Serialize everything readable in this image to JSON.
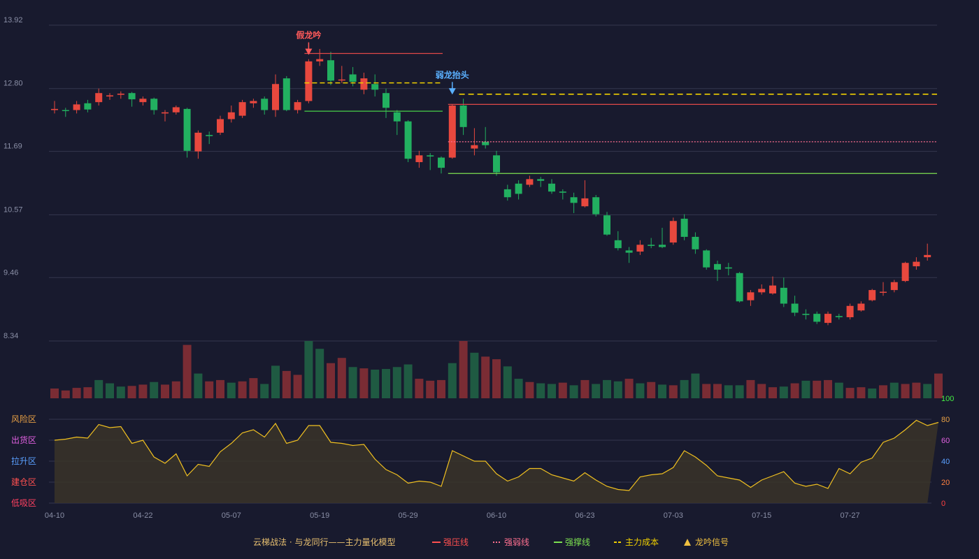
{
  "chart_data": {
    "type": "candlestick",
    "price_axis": {
      "ticks": [
        "13.92",
        "12.80",
        "11.69",
        "10.57",
        "9.46",
        "8.34"
      ],
      "min": 8.34,
      "max": 13.92
    },
    "date_ticks": [
      {
        "i": 0,
        "label": "04-10"
      },
      {
        "i": 8,
        "label": "04-22"
      },
      {
        "i": 16,
        "label": "05-07"
      },
      {
        "i": 24,
        "label": "05-19"
      },
      {
        "i": 32,
        "label": "05-29"
      },
      {
        "i": 40,
        "label": "06-10"
      },
      {
        "i": 48,
        "label": "06-23"
      },
      {
        "i": 56,
        "label": "07-03"
      },
      {
        "i": 64,
        "label": "07-15"
      },
      {
        "i": 72,
        "label": "07-27"
      }
    ],
    "candles": [
      [
        12.42,
        12.44,
        12.58,
        12.36
      ],
      [
        12.42,
        12.41,
        12.46,
        12.3
      ],
      [
        12.42,
        12.52,
        12.58,
        12.36
      ],
      [
        12.54,
        12.43,
        12.6,
        12.38
      ],
      [
        12.56,
        12.72,
        12.8,
        12.5
      ],
      [
        12.66,
        12.68,
        12.72,
        12.6
      ],
      [
        12.69,
        12.71,
        12.75,
        12.62
      ],
      [
        12.72,
        12.61,
        12.74,
        12.48
      ],
      [
        12.56,
        12.62,
        12.66,
        12.5
      ],
      [
        12.62,
        12.42,
        12.64,
        12.34
      ],
      [
        12.36,
        12.38,
        12.42,
        12.22
      ],
      [
        12.38,
        12.47,
        12.5,
        12.34
      ],
      [
        12.44,
        11.7,
        12.46,
        11.58
      ],
      [
        11.69,
        12.02,
        12.06,
        11.56
      ],
      [
        11.98,
        11.96,
        12.04,
        11.82
      ],
      [
        12.02,
        12.26,
        12.32,
        11.98
      ],
      [
        12.26,
        12.38,
        12.5,
        12.2
      ],
      [
        12.32,
        12.56,
        12.6,
        12.28
      ],
      [
        12.54,
        12.58,
        12.62,
        12.46
      ],
      [
        12.62,
        12.42,
        12.66,
        12.34
      ],
      [
        12.42,
        12.88,
        13.05,
        12.3
      ],
      [
        12.98,
        12.42,
        13.02,
        12.4
      ],
      [
        12.42,
        12.56,
        12.6,
        12.36
      ],
      [
        12.58,
        13.28,
        13.32,
        12.54
      ],
      [
        13.28,
        13.32,
        13.5,
        13.2
      ],
      [
        13.3,
        12.94,
        13.45,
        12.86
      ],
      [
        12.95,
        12.96,
        13.2,
        12.9
      ],
      [
        13.05,
        12.92,
        13.18,
        12.84
      ],
      [
        12.78,
        12.98,
        13.08,
        12.7
      ],
      [
        12.88,
        12.78,
        13.05,
        12.66
      ],
      [
        12.72,
        12.46,
        12.8,
        12.28
      ],
      [
        12.38,
        12.22,
        12.42,
        11.98
      ],
      [
        12.22,
        11.56,
        12.24,
        11.5
      ],
      [
        11.5,
        11.62,
        11.7,
        11.4
      ],
      [
        11.62,
        11.6,
        11.66,
        11.36
      ],
      [
        11.58,
        11.4,
        11.6,
        11.3
      ],
      [
        11.58,
        12.5,
        12.52,
        11.56
      ],
      [
        12.5,
        12.12,
        12.62,
        11.98
      ],
      [
        11.74,
        11.8,
        12.1,
        11.62
      ],
      [
        11.86,
        11.8,
        12.12,
        11.74
      ],
      [
        11.62,
        11.32,
        11.7,
        11.26
      ],
      [
        11.02,
        10.88,
        11.1,
        10.82
      ],
      [
        11.12,
        10.94,
        11.18,
        10.84
      ],
      [
        11.1,
        11.2,
        11.26,
        11.06
      ],
      [
        11.2,
        11.17,
        11.24,
        11.06
      ],
      [
        11.12,
        10.98,
        11.2,
        10.94
      ],
      [
        10.98,
        10.96,
        11.02,
        10.84
      ],
      [
        10.88,
        10.78,
        10.96,
        10.6
      ],
      [
        10.72,
        10.86,
        11.18,
        10.7
      ],
      [
        10.88,
        10.58,
        10.92,
        10.54
      ],
      [
        10.56,
        10.22,
        10.62,
        10.2
      ],
      [
        10.12,
        9.98,
        10.28,
        9.94
      ],
      [
        9.94,
        9.9,
        10.0,
        9.72
      ],
      [
        9.92,
        10.04,
        10.12,
        9.86
      ],
      [
        10.04,
        10.02,
        10.16,
        9.98
      ],
      [
        10.04,
        10.0,
        10.34,
        9.98
      ],
      [
        10.08,
        10.46,
        10.52,
        10.04
      ],
      [
        10.5,
        10.18,
        10.58,
        10.12
      ],
      [
        10.18,
        9.96,
        10.26,
        9.88
      ],
      [
        9.94,
        9.64,
        9.96,
        9.6
      ],
      [
        9.7,
        9.6,
        9.76,
        9.4
      ],
      [
        9.64,
        9.62,
        9.72,
        9.5
      ],
      [
        9.54,
        9.04,
        9.56,
        9.02
      ],
      [
        9.06,
        9.2,
        9.24,
        8.96
      ],
      [
        9.2,
        9.26,
        9.34,
        9.16
      ],
      [
        9.18,
        9.32,
        9.48,
        9.16
      ],
      [
        9.28,
        9.0,
        9.46,
        8.94
      ],
      [
        9.0,
        8.84,
        9.14,
        8.78
      ],
      [
        8.82,
        8.8,
        8.9,
        8.72
      ],
      [
        8.82,
        8.68,
        8.86,
        8.64
      ],
      [
        8.66,
        8.82,
        8.86,
        8.62
      ],
      [
        8.78,
        8.76,
        8.82,
        8.72
      ],
      [
        8.76,
        8.96,
        9.0,
        8.72
      ],
      [
        8.88,
        9.0,
        9.04,
        8.86
      ],
      [
        9.06,
        9.24,
        9.26,
        9.04
      ],
      [
        9.2,
        9.21,
        9.38,
        9.14
      ],
      [
        9.24,
        9.38,
        9.42,
        9.2
      ],
      [
        9.4,
        9.72,
        9.74,
        9.38
      ],
      [
        9.66,
        9.74,
        9.82,
        9.6
      ],
      [
        9.82,
        9.86,
        10.06,
        9.76
      ]
    ],
    "volume": [
      15,
      12,
      16,
      17,
      28,
      23,
      18,
      19,
      21,
      25,
      21,
      26,
      82,
      38,
      26,
      28,
      24,
      26,
      31,
      22,
      50,
      42,
      36,
      88,
      76,
      54,
      62,
      48,
      46,
      44,
      45,
      48,
      52,
      30,
      27,
      28,
      54,
      88,
      70,
      64,
      60,
      49,
      30,
      25,
      23,
      22,
      24,
      20,
      28,
      22,
      28,
      26,
      30,
      23,
      25,
      21,
      20,
      28,
      38,
      22,
      22,
      20,
      20,
      28,
      22,
      17,
      18,
      23,
      27,
      27,
      28,
      24,
      16,
      17,
      15,
      20,
      24,
      22,
      24,
      22,
      38
    ],
    "volume_colors": [
      "red",
      "red",
      "red",
      "red",
      "green",
      "green",
      "green",
      "red",
      "red",
      "green",
      "red",
      "red",
      "red",
      "green",
      "red",
      "red",
      "green",
      "red",
      "red",
      "green",
      "green",
      "red",
      "red",
      "green",
      "green",
      "red",
      "red",
      "green",
      "red",
      "green",
      "green",
      "green",
      "green",
      "red",
      "red",
      "red",
      "green",
      "red",
      "green",
      "red",
      "red",
      "green",
      "green",
      "red",
      "green",
      "green",
      "red",
      "green",
      "red",
      "green",
      "green",
      "green",
      "red",
      "green",
      "red",
      "green",
      "red",
      "green",
      "green",
      "red",
      "red",
      "green",
      "green",
      "red",
      "red",
      "red",
      "green",
      "red",
      "green",
      "red",
      "red",
      "green",
      "red",
      "red",
      "green",
      "red",
      "green",
      "red",
      "red",
      "green",
      "red"
    ],
    "indicator": [
      60,
      61,
      63,
      62,
      75,
      72,
      73,
      57,
      60,
      44,
      38,
      47,
      26,
      37,
      35,
      49,
      57,
      67,
      70,
      63,
      76,
      57,
      60,
      74,
      74,
      58,
      57,
      55,
      56,
      42,
      32,
      27,
      19,
      21,
      20,
      16,
      50,
      45,
      40,
      40,
      28,
      21,
      25,
      33,
      33,
      27,
      24,
      21,
      29,
      22,
      16,
      13,
      12,
      25,
      27,
      28,
      34,
      50,
      44,
      36,
      26,
      24,
      22,
      15,
      22,
      26,
      30,
      19,
      16,
      18,
      14,
      33,
      28,
      39,
      43,
      58,
      62,
      70,
      79,
      74,
      77
    ],
    "indicator_axis": {
      "ticks": [
        "100",
        "80",
        "60",
        "40",
        "20",
        "0"
      ],
      "min": 0,
      "max": 100
    },
    "zones": [
      {
        "label": "风险区",
        "color": "#e8a045",
        "value": 80
      },
      {
        "label": "出货区",
        "color": "#e060e0",
        "value": 60
      },
      {
        "label": "拉升区",
        "color": "#5aa0ff",
        "value": 40
      },
      {
        "label": "建仓区",
        "color": "#ff5050",
        "value": 20
      },
      {
        "label": "低吸区",
        "color": "#ff4060",
        "value": 0
      }
    ],
    "level_lines": [
      {
        "kind": "pressure",
        "from": 23,
        "to": 35,
        "value": 13.42,
        "color": "#e04848",
        "dash": ""
      },
      {
        "kind": "cost",
        "from": 23,
        "to": 35,
        "value": 12.9,
        "color": "#f0d000",
        "dash": "7,4"
      },
      {
        "kind": "support",
        "from": 23,
        "to": 35,
        "value": 12.4,
        "color": "#48d048",
        "dash": ""
      },
      {
        "kind": "cost",
        "from": 37,
        "to": 80,
        "value": 12.7,
        "color": "#f0d000",
        "dash": "8,5"
      },
      {
        "kind": "pressure",
        "from": 36,
        "to": 80,
        "value": 12.52,
        "color": "#e04848",
        "dash": ""
      },
      {
        "kind": "weak",
        "from": 36,
        "to": 80,
        "value": 11.86,
        "color": "#ff7090",
        "dash": "2,2"
      },
      {
        "kind": "support",
        "from": 36,
        "to": 80,
        "value": 11.3,
        "color": "#7ce050",
        "dash": ""
      }
    ],
    "signals": [
      {
        "i": 23,
        "label": "假龙吟",
        "color": "#ff5a5a",
        "price": 13.32
      },
      {
        "i": 36,
        "label": "弱龙抬头",
        "color": "#5ab0ff",
        "price": 12.62
      }
    ]
  },
  "legend": {
    "title": "云梯战法 · 与龙同行——主力量化模型",
    "items": [
      {
        "label": "强压线",
        "color": "#ff5050",
        "symbol": "line"
      },
      {
        "label": "强弱线",
        "color": "#ff7090",
        "symbol": "dotted"
      },
      {
        "label": "强撑线",
        "color": "#7ce050",
        "symbol": "line"
      },
      {
        "label": "主力成本",
        "color": "#f0d000",
        "symbol": "dashed"
      },
      {
        "label": "龙吟信号",
        "color": "#f0c040",
        "symbol": "triangle"
      }
    ]
  },
  "colors": {
    "up": "#e8483e",
    "down": "#22b060",
    "grid": "#34374e",
    "axis_text": "#8a8fa6",
    "indicator_line": "#f0c020"
  }
}
